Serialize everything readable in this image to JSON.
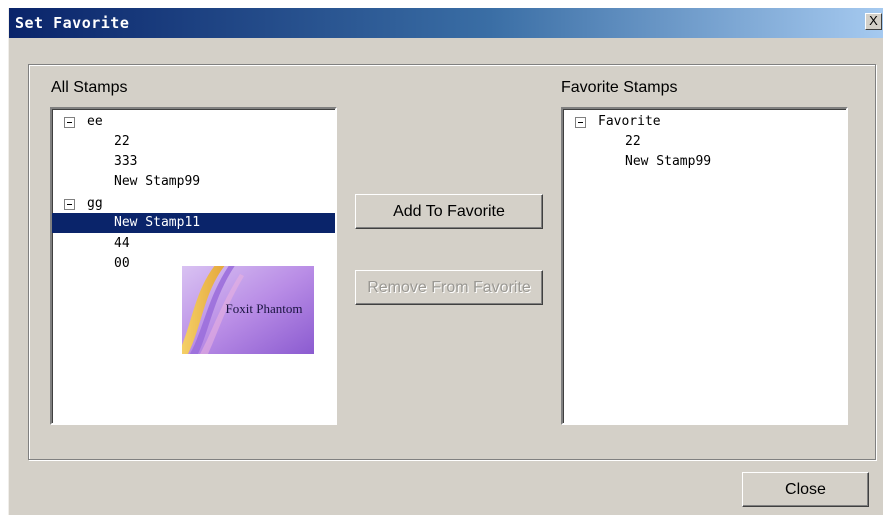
{
  "window": {
    "title": "Set Favorite",
    "close_glyph": "X"
  },
  "all_stamps": {
    "label": "All Stamps",
    "items": [
      {
        "label": "ee",
        "type": "group",
        "expanded": true
      },
      {
        "label": "22",
        "type": "stamp"
      },
      {
        "label": "333",
        "type": "stamp"
      },
      {
        "label": "New Stamp99",
        "type": "stamp"
      },
      {
        "label": "gg",
        "type": "group",
        "expanded": true
      },
      {
        "label": "New Stamp11",
        "type": "stamp",
        "selected": true
      },
      {
        "label": "44",
        "type": "stamp"
      },
      {
        "label": "00",
        "type": "stamp"
      }
    ],
    "preview": {
      "text": "Foxit Phantom"
    }
  },
  "favorite_stamps": {
    "label": "Favorite Stamps",
    "items": [
      {
        "label": "Favorite",
        "type": "group",
        "expanded": true
      },
      {
        "label": "22",
        "type": "stamp"
      },
      {
        "label": "New Stamp99",
        "type": "stamp"
      }
    ]
  },
  "buttons": {
    "add": "Add To Favorite",
    "remove": "Remove From Favorite",
    "remove_enabled": false,
    "close": "Close"
  },
  "colors": {
    "selection": "#0a246a",
    "dialog_face": "#d4d0c8"
  }
}
